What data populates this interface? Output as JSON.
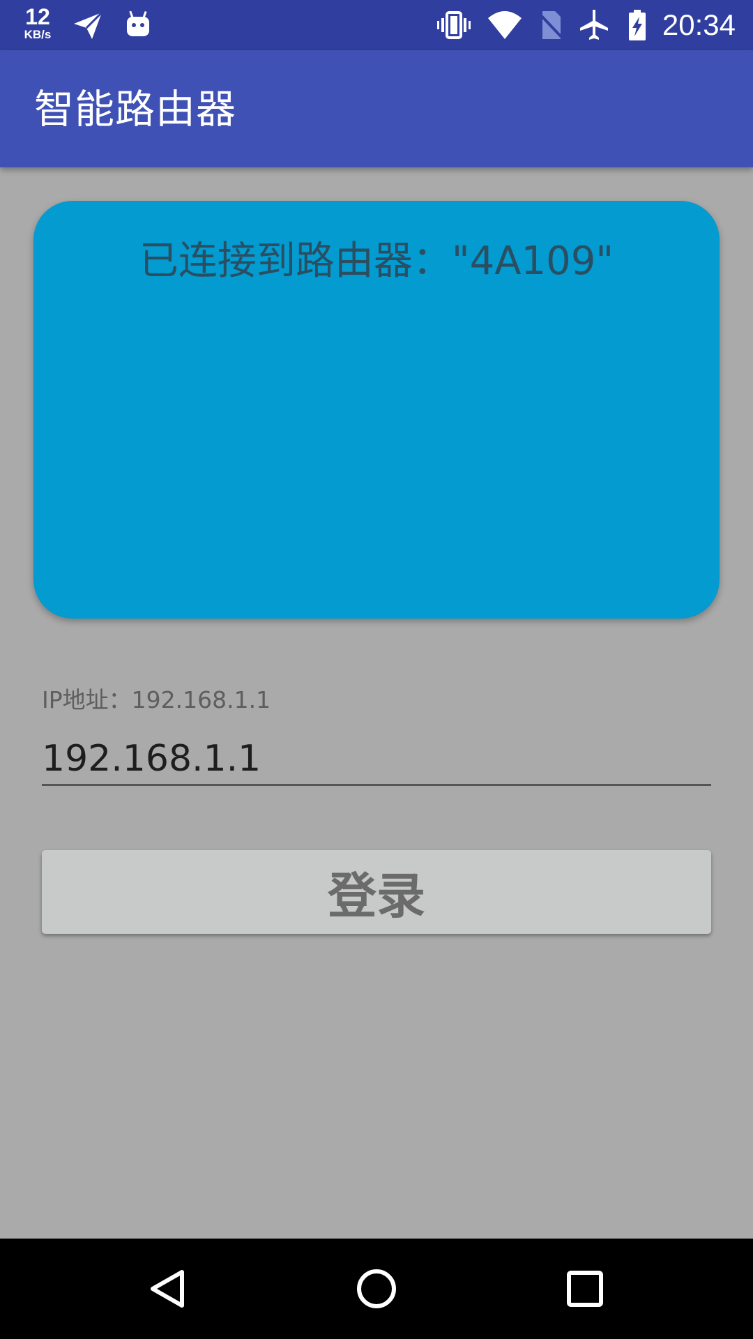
{
  "status_bar": {
    "net_speed_value": "12",
    "net_speed_unit": "KB/s",
    "time": "20:34",
    "left_icons": [
      "paper-plane-icon",
      "android-icon"
    ],
    "right_icons": [
      "vibrate-icon",
      "wifi-icon",
      "no-sim-icon",
      "airplane-mode-icon",
      "battery-charging-icon"
    ]
  },
  "app_bar": {
    "title": "智能路由器"
  },
  "connection_card": {
    "text": "已连接到路由器：\"4A109\""
  },
  "ip_field": {
    "label": "IP地址：192.168.1.1",
    "value": "192.168.1.1"
  },
  "login_button": {
    "label": "登录"
  },
  "nav_bar": {
    "buttons": [
      "back-icon",
      "home-icon",
      "recents-icon"
    ]
  },
  "colors": {
    "status_bar": "#303f9f",
    "app_bar": "#3f51b5",
    "background": "#aaaaaa",
    "card": "#039bd0",
    "card_text": "#2a4e62",
    "button": "#c8c9c9",
    "button_text": "#6b6b6b",
    "nav_bar": "#000000"
  }
}
